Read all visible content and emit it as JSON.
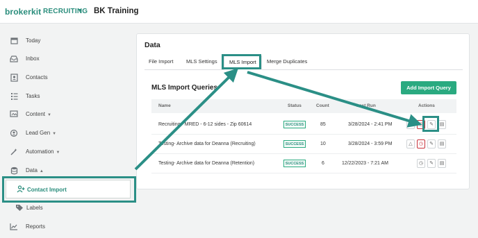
{
  "header": {
    "logo": "brokerkit",
    "module": "RECRUITING",
    "org": "BK Training"
  },
  "sidebar": {
    "items": [
      {
        "label": "Today",
        "icon": "calendar-icon"
      },
      {
        "label": "Inbox",
        "icon": "inbox-icon"
      },
      {
        "label": "Contacts",
        "icon": "contacts-icon"
      },
      {
        "label": "Tasks",
        "icon": "tasks-icon"
      },
      {
        "label": "Content",
        "icon": "content-icon"
      },
      {
        "label": "Lead Gen",
        "icon": "lead-gen-icon"
      },
      {
        "label": "Automation",
        "icon": "automation-icon"
      },
      {
        "label": "Data",
        "icon": "database-icon"
      },
      {
        "label": "Contact Import",
        "icon": "person-add-icon"
      },
      {
        "label": "Labels",
        "icon": "tag-icon"
      },
      {
        "label": "Reports",
        "icon": "chart-icon"
      }
    ]
  },
  "card": {
    "title": "Data",
    "tabs": [
      "File Import",
      "MLS Settings",
      "MLS Import",
      "Merge Duplicates"
    ],
    "active_tab": "MLS Import"
  },
  "section": {
    "title": "MLS Import Queries",
    "add_button": "Add Import Query"
  },
  "table": {
    "headers": {
      "name": "Name",
      "status": "Status",
      "count": "Count",
      "last_run": "Last Run",
      "actions": "Actions"
    },
    "rows": [
      {
        "name": "Recruiting - MRED - 6-12 sides - Zip 60614",
        "status": "SUCCESS",
        "count": "85",
        "last_run": "3/28/2024 - 2:41 PM"
      },
      {
        "name": "Testing- Archive data for Deanna (Recruiting)",
        "status": "SUCCESS",
        "count": "10",
        "last_run": "3/28/2024 - 3:59 PM"
      },
      {
        "name": "Testing- Archive data for Deanna (Retention)",
        "status": "SUCCESS",
        "count": "6",
        "last_run": "12/22/2023 - 7:21 AM"
      }
    ]
  },
  "colors": {
    "brand": "#2a8d7c",
    "button": "#2aaa80",
    "annotation": "#2b8f86",
    "danger": "#c7313a"
  }
}
